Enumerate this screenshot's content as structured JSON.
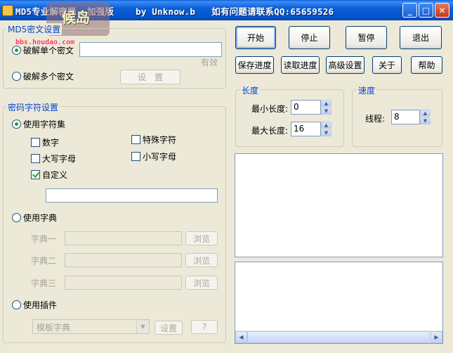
{
  "window": {
    "title": "MD5专业解密器  加强版    by Unknow.b   如有问题请联系QQ:65659526",
    "controls": {
      "minimize": "_",
      "maximize": "□",
      "close": "✕"
    },
    "watermark": {
      "logo": "候岛",
      "url": "bbs.houdao.com"
    }
  },
  "ciphertext_group": {
    "title": "MD5密文设置",
    "single_label": "破解单个密文",
    "single_value": "",
    "validity_text": "有效",
    "multiple_label": "破解多个密文",
    "settings_button": "设　置"
  },
  "charset_group": {
    "title": "密码字符设置",
    "use_charset_label": "使用字符集",
    "digits_label": "数字",
    "special_label": "特殊字符",
    "upper_label": "大写字母",
    "lower_label": "小写字母",
    "custom_label": "自定义",
    "custom_value": "",
    "use_dict_label": "使用字典",
    "dicts": [
      {
        "label": "字典一",
        "value": "",
        "browse": "浏览"
      },
      {
        "label": "字典二",
        "value": "",
        "browse": "浏览"
      },
      {
        "label": "字典三",
        "value": "",
        "browse": "浏览"
      }
    ],
    "use_plugin_label": "使用插件",
    "plugin_select": "模板字典",
    "plugin_settings_button": "设置",
    "plugin_help_button": "?"
  },
  "toolbar": {
    "start": "开始",
    "stop": "停止",
    "pause": "暂停",
    "exit": "退出",
    "save_progress": "保存进度",
    "load_progress": "读取进度",
    "advanced": "高级设置",
    "about": "关于",
    "help": "帮助"
  },
  "length_group": {
    "title": "长度",
    "min_label": "最小长度:",
    "min_value": "0",
    "max_label": "最大长度:",
    "max_value": "16"
  },
  "speed_group": {
    "title": "速度",
    "threads_label": "线程:",
    "threads_value": "8"
  },
  "colors": {
    "title_bar": "#0a5fd8",
    "group_title": "#0046d5",
    "check_mark": "#21a121"
  }
}
